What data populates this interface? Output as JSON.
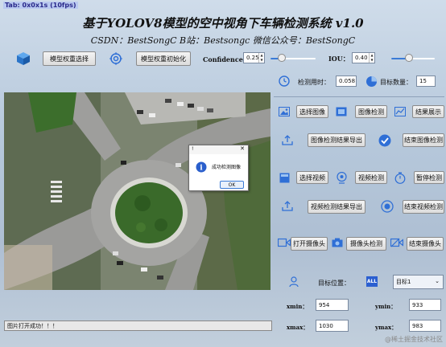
{
  "window": {
    "title_text": "Tab: 0x0x1s (10fps)"
  },
  "header": {
    "title": "基于YOLOV8模型的空中视角下车辆检测系统 v1.0",
    "subtitle": "CSDN：BestSongC   B站：Bestsongc   微信公众号：BestSongC"
  },
  "model": {
    "select_weights_label": "模型权重选择",
    "init_weights_label": "模型权重初始化"
  },
  "params": {
    "confidence_label": "Confidence:",
    "confidence_value": "0.25",
    "confidence_level": 0.25,
    "iou_label": "IOU：",
    "iou_value": "0.40",
    "iou_level": 0.4
  },
  "stats": {
    "detect_time_label": "检测用时：",
    "detect_time_value": "0.058",
    "target_count_label": "目标数量：",
    "target_count_value": "15"
  },
  "image_controls": {
    "select_image": "选择图像",
    "detect_image": "图像检测",
    "show_result": "结果展示",
    "export_image_result": "图像检测结果导出",
    "end_image_detect": "结束图像检测"
  },
  "video_controls": {
    "select_video": "选择视频",
    "detect_video": "视频检测",
    "pause_detect": "暂停检测",
    "export_video_result": "视频检测结果导出",
    "end_video_detect": "结束视频检测"
  },
  "camera_controls": {
    "open_camera": "打开摄像头",
    "camera_detect": "摄像头检测",
    "close_camera": "结束摄像头"
  },
  "target": {
    "position_label": "目标位置：",
    "all_badge": "ALL",
    "selected_target": "目标1",
    "xmin_label": "xmin：",
    "xmin_value": "954",
    "ymin_label": "ymin：",
    "ymin_value": "933",
    "xmax_label": "xmax：",
    "xmax_value": "1030",
    "ymax_label": "ymax：",
    "ymax_value": "983"
  },
  "dialog": {
    "title": "!",
    "message": "成功检测图像",
    "ok_label": "OK"
  },
  "status": {
    "message": "图片打开成功！！！"
  },
  "watermark": "@稀土掘金技术社区",
  "colors": {
    "accent": "#2f6fd6",
    "badge": "#2b5fd0"
  }
}
